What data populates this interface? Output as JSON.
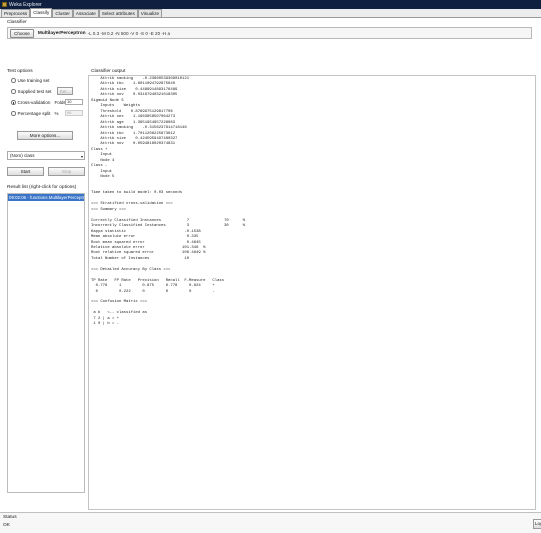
{
  "window": {
    "title": "Weka Explorer"
  },
  "tabs": [
    "Preprocess",
    "Classify",
    "Cluster",
    "Associate",
    "Select attributes",
    "Visualize"
  ],
  "active_tab": "Classify",
  "classifier": {
    "label": "Classifier",
    "choose_label": "Choose",
    "name": "MultilayerPerceptron",
    "args": "-L 0.3 -M 0.2 -N 500 -V 0 -S 0 -E 20 -H a"
  },
  "test_options": {
    "label": "Test options",
    "use_training_set": "Use training set",
    "supplied_test_set": "Supplied test set",
    "set_label": "Set...",
    "cross_validation": "Cross-validation",
    "folds_label": "Folds",
    "folds_value": "10",
    "percentage_split": "Percentage split",
    "percent_label": "%",
    "percent_value": "66",
    "more_options": "More options..."
  },
  "class_select": {
    "value": "(Nom) class"
  },
  "actions": {
    "start": "Start",
    "stop": "Stop"
  },
  "result_list": {
    "label": "Result list (right-click for options)",
    "items": [
      "09:02:06 - functions.MultilayerPerceptron"
    ]
  },
  "output": {
    "label": "Classifier output",
    "lines": [
      "    Attrib smoking    -0.23660539309010121",
      "    Attrib tbc    1.6011094792875640",
      "    Attrib size    0.4489914893176489",
      "    Attrib nov    0.03167940321018305",
      "Sigmoid Node 5",
      "    Inputs    Weights",
      "    Threshold    0.8769975129617706",
      "    Attrib sex    1.1963858507064273",
      "    Attrib age    1.3651954957228083",
      "    Attrib smoking    -0.3156237914718148",
      "    Attrib tbc    1.7011206225873612",
      "    Attrib size    0.4245959497480327",
      "    Attrib nov    0.0594816020374831",
      "Class +",
      "    Input",
      "    Node 4",
      "Class -",
      "    Input",
      "    Node 5",
      "",
      "",
      "Time taken to build model: 0.03 seconds",
      "",
      "=== Stratified cross-validation ===",
      "=== Summary ===",
      "",
      "Correctly Classified Instances           7               70      %",
      "Incorrectly Classified Instances         3               30      %",
      "Kappa statistic                         -0.1538",
      "Mean absolute error                      0.335",
      "Root mean squared error                  0.4645",
      "Relative absolute error                101.346  %",
      "Root relative squared error            106.4849 %",
      "Total Number of Instances               10",
      "",
      "=== Detailed Accuracy By Class ===",
      "",
      "TP Rate   FP Rate   Precision   Recall  F-Measure   Class",
      "  0.778     1         0.875     0.778     0.824     +",
      "  0         0.222     0         0         0         -",
      "",
      "=== Confusion Matrix ===",
      "",
      " a b   <-- classified as",
      " 7 2 | a = +",
      " 1 0 | b = -"
    ]
  },
  "status": {
    "label": "Status",
    "value": "OK",
    "log_label": "Log"
  }
}
